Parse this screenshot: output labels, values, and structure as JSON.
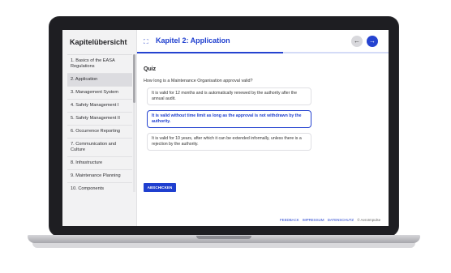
{
  "sidebar": {
    "title": "Kapitelübersicht",
    "items": [
      {
        "label": "1. Basics of the EASA Regulations"
      },
      {
        "label": "2. Application"
      },
      {
        "label": "3. Management System"
      },
      {
        "label": "4. Safety Management I"
      },
      {
        "label": "5. Safety Management II"
      },
      {
        "label": "6. Occurrence Reporting"
      },
      {
        "label": "7. Communication and Culture"
      },
      {
        "label": "8. Infrastructure"
      },
      {
        "label": "9. Maintenance Planning"
      },
      {
        "label": "10. Components"
      }
    ]
  },
  "header": {
    "title": "Kapitel 2: Application",
    "progress": 0.58
  },
  "quiz": {
    "heading": "Quiz",
    "question": "How long is a Maintenance Organisation approval valid?",
    "answers": [
      {
        "text": "It is valid for 12 months and is automatically renewed by the authority after the annual audit.",
        "selected": false
      },
      {
        "text": "It is valid without time limit as long as the approval is not withdrawn by the authority.",
        "selected": true
      },
      {
        "text": "It is valid for 10 years, after which it can be extended informally, unless there is a rejection by the authority.",
        "selected": false
      }
    ],
    "submit_label": "ABSCHICKEN"
  },
  "footer": {
    "feedback": "FEEDBACK",
    "impressum": "IMPRESSUM",
    "datenschutz": "DATENSCHUTZ",
    "copyright": "© AeroImpulse"
  },
  "colors": {
    "accent": "#1f3fcf",
    "bezel": "#1e1e22"
  }
}
